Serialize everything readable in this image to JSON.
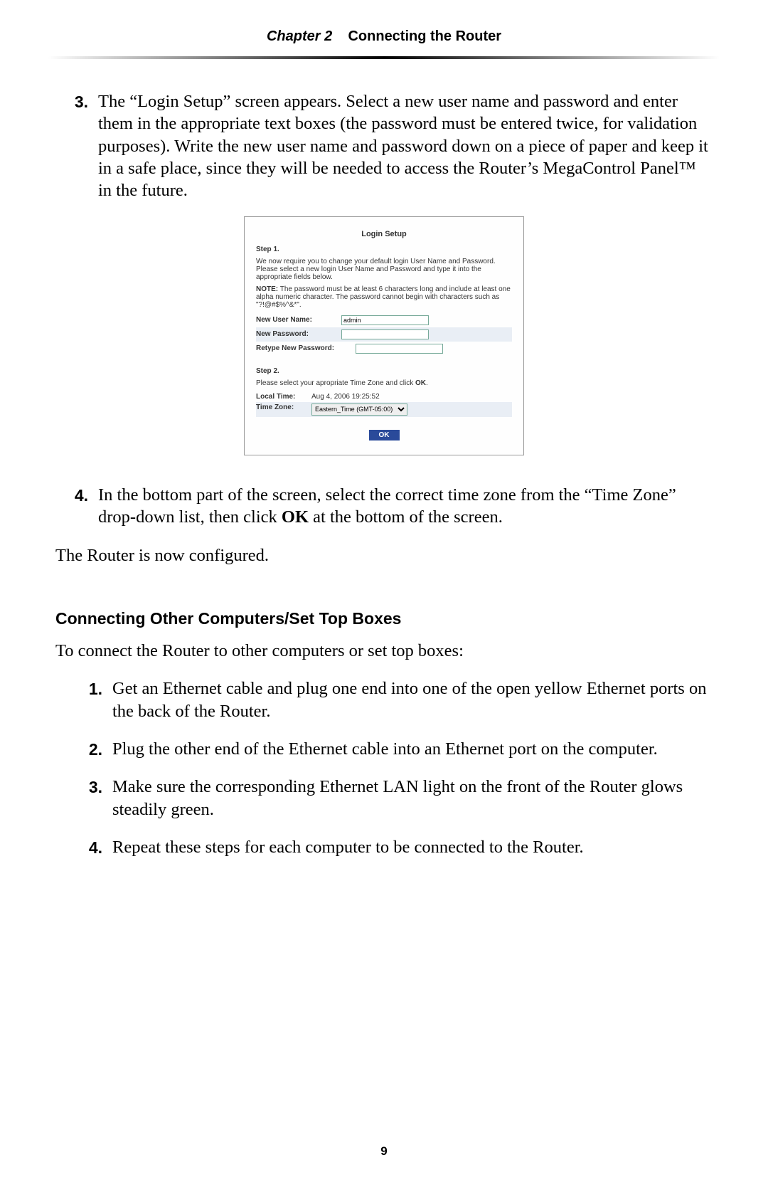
{
  "header": {
    "chapter_label": "Chapter 2",
    "chapter_title": "Connecting the Router"
  },
  "steps": {
    "s3_num": "3.",
    "s3_text": "The “Login Setup” screen appears. Select a new user name and password and enter them in the appropriate text boxes (the password must be entered twice, for validation purposes). Write the new user name and password down on a piece of paper and keep it in a safe place, since they will be needed to access the Router’s MegaControl Panel™ in the future.",
    "s4_num": "4.",
    "s4_text_pre": "In the bottom part of the screen, select the correct time zone from the “Time Zone” drop-down list, then click ",
    "s4_ok": "OK",
    "s4_text_post": " at the bottom of the screen."
  },
  "configured": "The Router is now configured.",
  "sub_heading": "Connecting Other Computers/Set Top Boxes",
  "sub_intro": "To connect the Router to other computers or set top boxes:",
  "sub": {
    "s1_num": "1.",
    "s1": "Get an Ethernet cable and plug one end into one of the open yellow Ethernet ports on the back of the Router.",
    "s2_num": "2.",
    "s2": "Plug the other end of the Ethernet cable into an Ethernet port on the computer.",
    "s3_num": "3.",
    "s3_pre": "Make sure the corresponding Ethernet ",
    "s3_lan": "LAN",
    "s3_post": " light on the front of the Router glows steadily green.",
    "s4_num": "4.",
    "s4": "Repeat these steps for each computer to be connected to the Router."
  },
  "shot": {
    "title": "Login Setup",
    "step1": "Step 1.",
    "intro": "We now require you to change your default login User Name and Password. Please select a new login User Name and Password and type it into the appropriate fields below.",
    "note_label": "NOTE:",
    "note": " The password must be at least 6 characters long and include at least one alpha numeric character. The password cannot begin with characters such as \"?!@#$%^&*\".",
    "new_user_label": "New User Name:",
    "new_user_value": "admin",
    "new_pass_label": "New Password:",
    "retype_label": "Retype New Password:",
    "step2": "Step 2.",
    "step2_text_pre": "Please select your apropriate Time Zone and click ",
    "step2_ok": "OK",
    "step2_text_post": ".",
    "local_time_label": "Local Time:",
    "local_time_value": "Aug 4, 2006 19:25:52",
    "tz_label": "Time Zone:",
    "tz_value": "Eastern_Time (GMT-05:00)",
    "ok": "OK"
  },
  "page_number": "9"
}
